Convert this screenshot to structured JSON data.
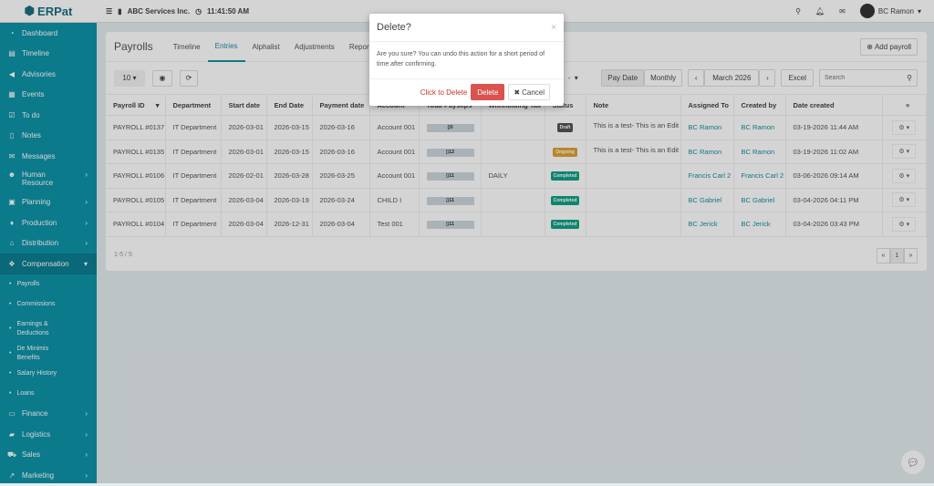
{
  "header": {
    "logo": "ERPat",
    "company": "ABC Services Inc.",
    "time": "11:41:50 AM",
    "user": "BC Ramon"
  },
  "sidebar": {
    "items": [
      {
        "label": "Dashboard",
        "icon": "dashboard-icon",
        "glyph": "◔"
      },
      {
        "label": "Timeline",
        "icon": "timeline-icon",
        "glyph": "▤"
      },
      {
        "label": "Advisories",
        "icon": "megaphone-icon",
        "glyph": "◀"
      },
      {
        "label": "Events",
        "icon": "calendar-icon",
        "glyph": "▦"
      },
      {
        "label": "To do",
        "icon": "checkbox-icon",
        "glyph": "☑"
      },
      {
        "label": "Notes",
        "icon": "note-icon",
        "glyph": "▯"
      },
      {
        "label": "Messages",
        "icon": "messages-icon",
        "glyph": "✉"
      },
      {
        "label": "Human Resource",
        "icon": "users-icon",
        "glyph": "☻"
      },
      {
        "label": "Planning",
        "icon": "briefcase-icon",
        "glyph": "▣"
      },
      {
        "label": "Production",
        "icon": "flask-icon",
        "glyph": "♦"
      },
      {
        "label": "Distribution",
        "icon": "bank-icon",
        "glyph": "⌂"
      },
      {
        "label": "Compensation",
        "icon": "money-icon",
        "glyph": "❖"
      }
    ],
    "sub": [
      "Payrolls",
      "Commissions",
      "Earnings & Deductions",
      "De Minimis Benefits",
      "Salary History",
      "Loans"
    ],
    "after": [
      {
        "label": "Finance",
        "icon": "wallet-icon",
        "glyph": "▭"
      },
      {
        "label": "Logistics",
        "icon": "truck-icon",
        "glyph": "▰"
      },
      {
        "label": "Sales",
        "icon": "cart-icon",
        "glyph": "⛟"
      },
      {
        "label": "Marketing",
        "icon": "chart-icon",
        "glyph": "↗"
      }
    ]
  },
  "page": {
    "title": "Payrolls",
    "tabs": [
      "Timeline",
      "Entries",
      "Alphalist",
      "Adjustments",
      "Reports"
    ],
    "add_label": "Add payroll",
    "page_size": "10",
    "filter_value": "-",
    "pay_date": "Pay Date",
    "monthly": "Monthly",
    "month": "March 2026",
    "excel": "Excel",
    "search_placeholder": "Search"
  },
  "table": {
    "headers": [
      "Payroll ID",
      "Department",
      "Start date",
      "End Date",
      "Payment date",
      "Account",
      "Total Payslips",
      "Withholding Tax",
      "Status",
      "Note",
      "Assigned To",
      "Created by",
      "Date created"
    ],
    "rows": [
      {
        "id": "PAYROLL #0137",
        "dept": "IT Department",
        "start": "2026-03-01",
        "end": "2026-03-15",
        "pay": "2026-03-16",
        "account": "Account 001",
        "slips": "0",
        "tax": "",
        "status": "Draft",
        "note": "This is a test- This is an Edit",
        "assigned": "BC Ramon",
        "created": "BC Ramon",
        "date": "03-19-2026 11:44 AM"
      },
      {
        "id": "PAYROLL #0135",
        "dept": "IT Department",
        "start": "2026-03-01",
        "end": "2026-03-15",
        "pay": "2026-03-16",
        "account": "Account 001",
        "slips": "12",
        "tax": "",
        "status": "Ongoing",
        "note": "This is a test- This is an Edit",
        "assigned": "BC Ramon",
        "created": "BC Ramon",
        "date": "03-19-2026 11:02 AM"
      },
      {
        "id": "PAYROLL #0106",
        "dept": "IT Department",
        "start": "2026-02-01",
        "end": "2026-03-28",
        "pay": "2026-03-25",
        "account": "Account 001",
        "slips": "11",
        "tax": "DAILY",
        "status": "Completed",
        "note": "",
        "assigned": "Francis Carl 2",
        "created": "Francis Carl 2",
        "date": "03-06-2026 09:14 AM"
      },
      {
        "id": "PAYROLL #0105",
        "dept": "IT Department",
        "start": "2026-03-04",
        "end": "2026-03-19",
        "pay": "2026-03-24",
        "account": "CHILD I",
        "slips": "11",
        "tax": "",
        "status": "Completed",
        "note": "",
        "assigned": "BC Gabriel",
        "created": "BC Gabriel",
        "date": "03-04-2026 04:11 PM"
      },
      {
        "id": "PAYROLL #0104",
        "dept": "IT Department",
        "start": "2026-03-04",
        "end": "2026-12-31",
        "pay": "2026-03-04",
        "account": "Test 001",
        "slips": "11",
        "tax": "",
        "status": "Completed",
        "note": "",
        "assigned": "BC Jerick",
        "created": "BC Jerick",
        "date": "03-04-2026 03:43 PM"
      }
    ],
    "footer": "1-5 / 5",
    "page": "1"
  },
  "status_colors": {
    "Draft": "#555555",
    "Ongoing": "#e0a030",
    "Completed": "#13a085"
  },
  "modal": {
    "title": "Delete?",
    "body": "Are you sure? You can undo this action for a short period of time after confirming.",
    "click_label": "Click to Delete",
    "delete": "Delete",
    "cancel": "Cancel"
  }
}
